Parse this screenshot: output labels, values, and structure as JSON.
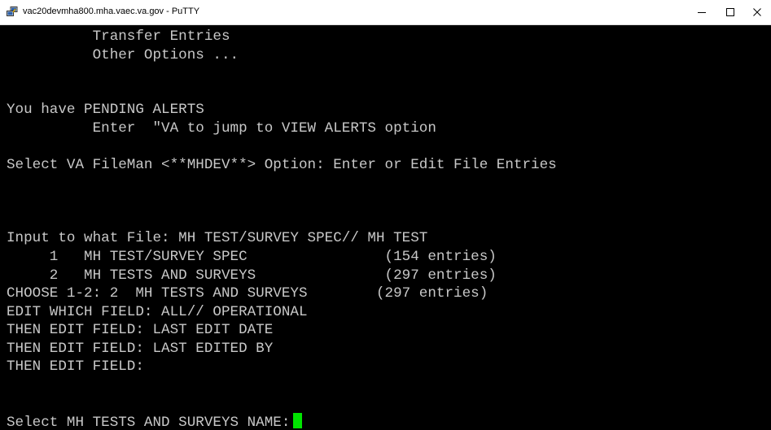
{
  "window": {
    "title": "vac20devmha800.mha.vaec.va.gov - PuTTY",
    "icon": "putty-icon",
    "controls": [
      "minimize-icon",
      "maximize-icon",
      "close-icon"
    ]
  },
  "terminal": {
    "text_color": "#c8c8c8",
    "background": "#000000",
    "cursor_color": "#00e400",
    "lines": [
      "          Transfer Entries",
      "          Other Options ...",
      "",
      "",
      "You have PENDING ALERTS",
      "          Enter  \"VA to jump to VIEW ALERTS option",
      "",
      "Select VA FileMan <**MHDEV**> Option: Enter or Edit File Entries",
      "",
      "",
      "",
      "Input to what File: MH TEST/SURVEY SPEC// MH TEST",
      "     1   MH TEST/SURVEY SPEC                (154 entries)",
      "     2   MH TESTS AND SURVEYS               (297 entries)",
      "CHOOSE 1-2: 2  MH TESTS AND SURVEYS        (297 entries)",
      "EDIT WHICH FIELD: ALL// OPERATIONAL",
      "THEN EDIT FIELD: LAST EDIT DATE",
      "THEN EDIT FIELD: LAST EDITED BY",
      "THEN EDIT FIELD:",
      "",
      "",
      "Select MH TESTS AND SURVEYS NAME:"
    ]
  }
}
